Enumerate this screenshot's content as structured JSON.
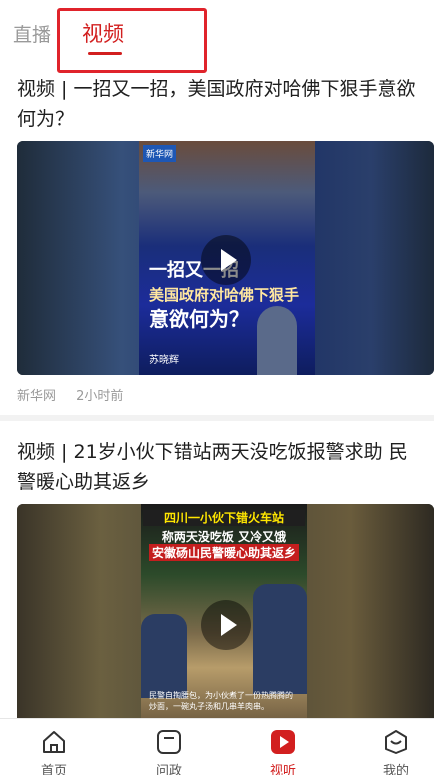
{
  "tabs": {
    "live": "直播",
    "video": "视频"
  },
  "articles": [
    {
      "title": "视频 | 一招又一招，美国政府对哈佛下狠手意欲何为？",
      "source": "新华网",
      "time": "2小时前",
      "poster": {
        "badge": "新华网",
        "caption_top": "一招又一招",
        "caption_mid": "美国政府对哈佛下狠手",
        "caption_bottom": "意欲何为？",
        "name": "苏晓辉"
      }
    },
    {
      "title": "视频 | 21岁小伙下错站两天没吃饭报警求助 民警暖心助其返乡",
      "poster": {
        "caption_top": "四川一小伙下错火车站",
        "caption_mid": "称两天没吃饭 又冷又饿",
        "caption_red": "安徽砀山民警暖心助其返乡",
        "caption_bottom": "民警自掏腰包，为小伙煮了一份热腾腾的炒面，一碗丸子汤和几串羊肉串。"
      }
    }
  ],
  "bottom_nav": [
    {
      "label": "首页",
      "icon": "home-icon"
    },
    {
      "label": "问政",
      "icon": "inquiry-icon"
    },
    {
      "label": "视听",
      "icon": "video-play-icon"
    },
    {
      "label": "我的",
      "icon": "profile-icon"
    }
  ],
  "colors": {
    "accent": "#d21f1f",
    "highlight_box": "#e0232b"
  }
}
